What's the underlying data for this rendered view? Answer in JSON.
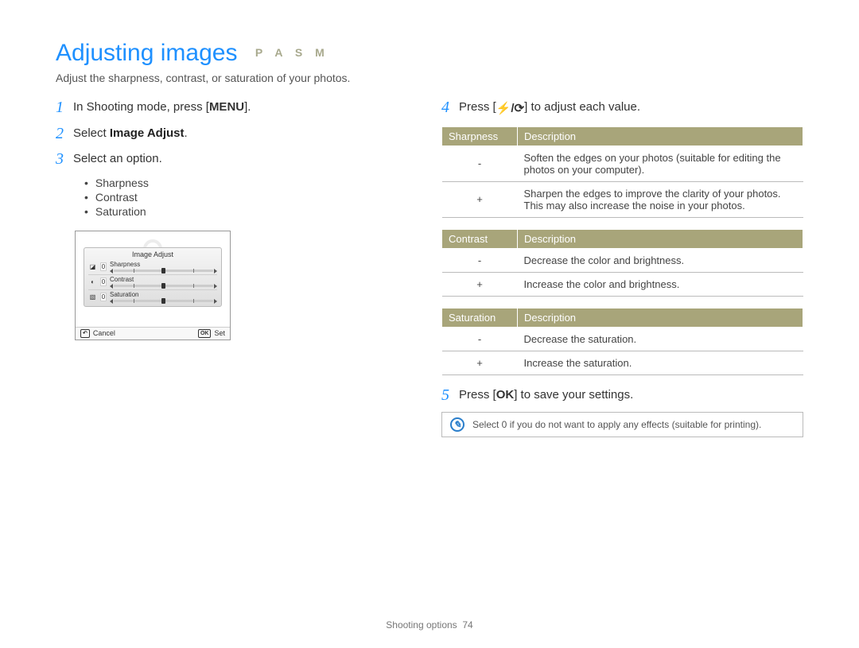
{
  "header": {
    "title": "Adjusting images",
    "modes": "P A S M",
    "subtitle": "Adjust the sharpness, contrast, or saturation of your photos."
  },
  "steps": {
    "s1_pre": "In Shooting mode, press [",
    "s1_btn": "MENU",
    "s1_post": "].",
    "s2_pre": "Select ",
    "s2_bold": "Image Adjust",
    "s2_post": ".",
    "s3": "Select an option.",
    "s4_pre": "Press [",
    "s4_icons": "⚡/⟳",
    "s4_post": "] to adjust each value.",
    "s5_pre": "Press [",
    "s5_btn": "OK",
    "s5_post": "] to save your settings."
  },
  "bullets": [
    "Sharpness",
    "Contrast",
    "Saturation"
  ],
  "mock": {
    "title": "Image Adjust",
    "rows": [
      {
        "icon": "◪",
        "val": "0",
        "label": "Sharpness"
      },
      {
        "icon": "◐",
        "val": "0",
        "label": "Contrast"
      },
      {
        "icon": "▧",
        "val": "0",
        "label": "Saturation"
      }
    ],
    "cancel_icon": "↶",
    "cancel": "Cancel",
    "set_icon": "OK",
    "set": "Set"
  },
  "tables": {
    "sharpness": {
      "h1": "Sharpness",
      "h2": "Description",
      "rows": [
        {
          "s": "-",
          "d": "Soften the edges on your photos (suitable for editing the photos on your computer)."
        },
        {
          "s": "+",
          "d": "Sharpen the edges to improve the clarity of your photos. This may also increase the noise in your photos."
        }
      ]
    },
    "contrast": {
      "h1": "Contrast",
      "h2": "Description",
      "rows": [
        {
          "s": "-",
          "d": "Decrease the color and brightness."
        },
        {
          "s": "+",
          "d": "Increase the color and brightness."
        }
      ]
    },
    "saturation": {
      "h1": "Saturation",
      "h2": "Description",
      "rows": [
        {
          "s": "-",
          "d": "Decrease the saturation."
        },
        {
          "s": "+",
          "d": "Increase the saturation."
        }
      ]
    }
  },
  "note": "Select 0 if you do not want to apply any effects (suitable for printing).",
  "footer": {
    "section": "Shooting options",
    "page": "74"
  }
}
